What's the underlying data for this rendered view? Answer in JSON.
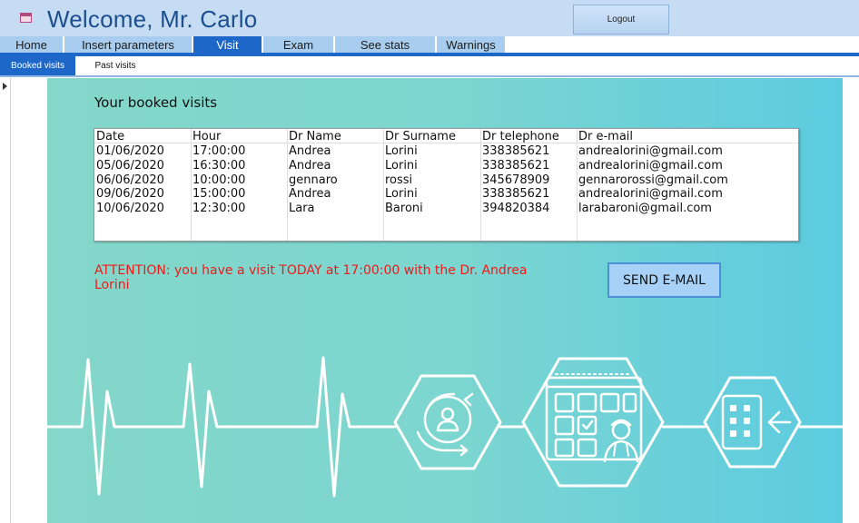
{
  "window": {
    "title": "Welcome, Mr. Carlo",
    "logout_label": "Logout"
  },
  "nav": {
    "tabs": [
      {
        "label": "Home"
      },
      {
        "label": "Insert parameters"
      },
      {
        "label": "Visit",
        "active": true
      },
      {
        "label": "Exam"
      },
      {
        "label": "See stats"
      },
      {
        "label": "Warnings"
      }
    ]
  },
  "subnav": {
    "tabs": [
      {
        "label": "Booked visits",
        "active": true
      },
      {
        "label": "Past visits"
      }
    ]
  },
  "visits": {
    "heading": "Your booked visits",
    "columns": [
      "Date",
      "Hour",
      "Dr Name",
      "Dr Surname",
      "Dr telephone",
      "Dr e-mail"
    ],
    "rows": [
      [
        "01/06/2020",
        "17:00:00",
        "Andrea",
        "Lorini",
        "338385621",
        "andrealorini@gmail.com"
      ],
      [
        "05/06/2020",
        "16:30:00",
        "Andrea",
        "Lorini",
        "338385621",
        "andrealorini@gmail.com"
      ],
      [
        "06/06/2020",
        "10:00:00",
        "gennaro",
        "rossi",
        "345678909",
        "gennarorossi@gmail.com"
      ],
      [
        "09/06/2020",
        "15:00:00",
        "Andrea",
        "Lorini",
        "338385621",
        "andrealorini@gmail.com"
      ],
      [
        "10/06/2020",
        "12:30:00",
        "Lara",
        "Baroni",
        "394820384",
        "larabaroni@gmail.com"
      ]
    ],
    "attention_text": "ATTENTION: you have a visit TODAY at 17:00:00 with the Dr. Andrea Lorini",
    "send_email_label": "SEND E-MAIL"
  },
  "colors": {
    "accent": "#1c67c8",
    "tab": "#a8cdee",
    "alert": "#ef1a1a",
    "panel_start": "#84d7c9",
    "panel_end": "#5ccbe0"
  },
  "icons": [
    "form-icon",
    "heartbeat-line",
    "patient-refresh-icon",
    "calendar-doctor-icon",
    "hospital-building-icon"
  ]
}
